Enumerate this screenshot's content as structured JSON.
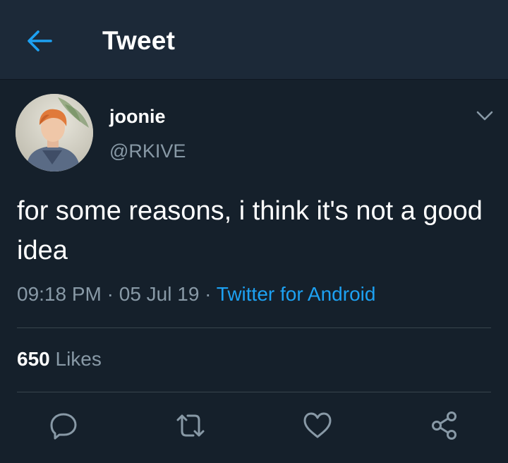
{
  "header": {
    "back_icon": "arrow-left-icon",
    "title": "Tweet"
  },
  "tweet": {
    "author": {
      "display_name": "joonie",
      "handle": "@RKIVE",
      "avatar_icon": "profile-photo"
    },
    "menu_icon": "chevron-down-icon",
    "text": "for some reasons, i think it's not a good idea",
    "time": "09:18 PM",
    "separator": "·",
    "date": "05 Jul 19",
    "source": "Twitter for Android",
    "likes_count": "650",
    "likes_label": "Likes",
    "actions": [
      "reply-icon",
      "retweet-icon",
      "like-icon",
      "share-icon"
    ]
  },
  "colors": {
    "background": "#15202b",
    "header_background": "#1c2938",
    "accent": "#1da1f2",
    "secondary_text": "#8899a6",
    "divider": "#38444d"
  }
}
